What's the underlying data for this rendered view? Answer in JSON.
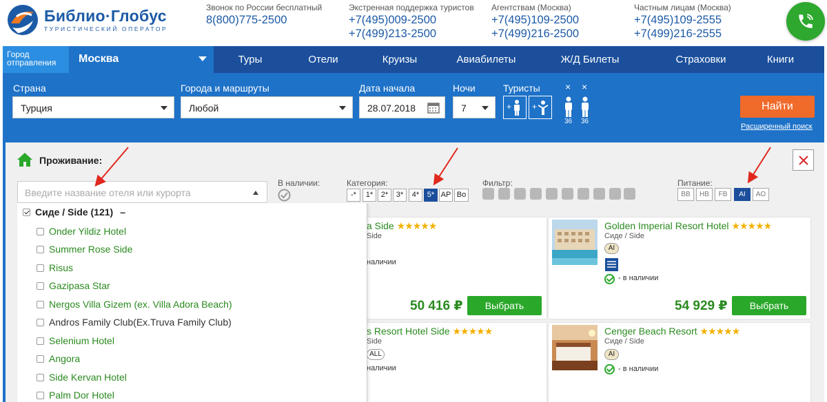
{
  "logo": {
    "title": "Библио·Глобус",
    "subtitle": "ТУРИСТИЧЕСКИЙ ОПЕРАТОР"
  },
  "contacts": [
    {
      "label": "Звонок по России бесплатный",
      "phones": [
        "8(800)775-2500"
      ]
    },
    {
      "label": "Экстренная поддержка туристов",
      "phones": [
        "+7(495)009-2500",
        "+7(499)213-2500"
      ]
    },
    {
      "label": "Агентствам (Москва)",
      "phones": [
        "+7(495)109-2500",
        "+7(499)216-2500"
      ]
    },
    {
      "label": "Частным лицам (Москва)",
      "phones": [
        "+7(495)109-2555",
        "+7(499)216-2555"
      ]
    }
  ],
  "nav": {
    "city_label": "Город отправления",
    "city": "Москва",
    "items": [
      "Туры",
      "Отели",
      "Круизы",
      "Авиабилеты",
      "Ж/Д Билеты",
      "Страховки",
      "Книги"
    ]
  },
  "search": {
    "country_label": "Страна",
    "country": "Турция",
    "routes_label": "Города и маршруты",
    "route": "Любой",
    "date_label": "Дата начала",
    "date": "28.07.2018",
    "nights_label": "Ночи",
    "nights": "7",
    "tourists_label": "Туристы",
    "remove_mark": "×",
    "ages": [
      "36",
      "36"
    ],
    "find_button": "Найти",
    "advanced_link": "Расширенный поиск"
  },
  "accommodation": {
    "title": "Проживание:",
    "hotel_placeholder": "Введите название отеля или курорта",
    "availability_label": "В наличии:",
    "category_label": "Категория:",
    "categories": [
      "-*",
      "1*",
      "2*",
      "3*",
      "4*",
      "5*",
      "AP",
      "Bo"
    ],
    "category_active": "5*",
    "filter_label": "Фильтр:",
    "meal_label": "Питание:",
    "meals": [
      "BB",
      "HB",
      "FB",
      "AI",
      "AO"
    ],
    "meal_active": "AI"
  },
  "dropdown": {
    "group": "Сиде / Side (121)",
    "group_toggle": "–",
    "items": [
      "Onder Yildiz Hotel",
      "Summer Rose Side",
      "Risus",
      "Gazipasa Star",
      "Nergos Villa Gizem (ex. Villa Adora Beach)",
      "Andros Family Club(Ex.Truva Family Club)",
      "Selenium Hotel",
      "Angora",
      "Side Kervan Hotel",
      "Palm Dor Hotel"
    ]
  },
  "cards": [
    {
      "name_visible": "a Side",
      "stars": "★★★★★",
      "loc_visible": "Side",
      "avail_visible": "наличии",
      "price": "50 416 ₽",
      "button": "Выбрать"
    },
    {
      "name": "Golden Imperial Resort Hotel",
      "stars": "★★★★★",
      "loc": "Сиде / Side",
      "meal": "AI",
      "avail": "- в наличии",
      "price": "54 929 ₽",
      "button": "Выбрать"
    },
    {
      "name_visible": "s Resort Hotel Side",
      "stars": "★★★★★",
      "loc_visible": "Side",
      "meal": "ALL",
      "avail_visible": "наличии"
    },
    {
      "name": "Cenger Beach Resort",
      "stars": "★★★★★",
      "loc": "Сиде / Side",
      "meal": "AI",
      "avail": "- в наличии"
    }
  ],
  "colors": {
    "brand_blue": "#1b4f9c",
    "accent_blue": "#1e72c8",
    "orange": "#f06a2a",
    "green": "#2aa82a",
    "arrow_red": "#e0281e"
  }
}
